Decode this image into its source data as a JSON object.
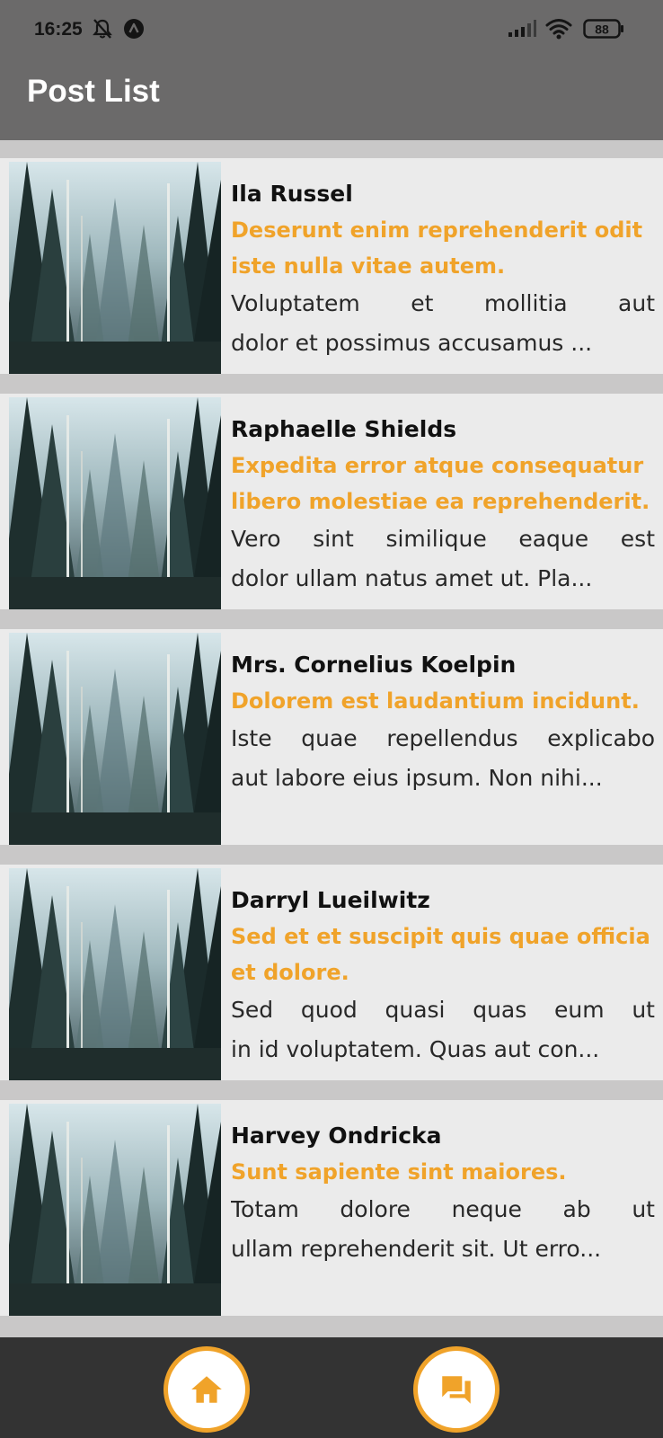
{
  "status_bar": {
    "time": "16:25",
    "battery_level": "88",
    "icons": [
      "muted-bell-icon",
      "app-notification-icon",
      "signal-icon",
      "wifi-icon",
      "battery-icon"
    ]
  },
  "app_bar": {
    "title": "Post List"
  },
  "colors": {
    "accent": "#f0a32a",
    "app_bar": "#6b6a6a",
    "bottom_nav": "#333333",
    "card": "#ebebeb",
    "list_background": "#c9c8c8"
  },
  "posts": [
    {
      "author": "Ila Russel",
      "title": "Deserunt enim reprehenderit odit iste nulla vitae autem.",
      "excerpt_line1": "Voluptatem et mollitia aut",
      "excerpt_line2": "dolor et possimus accusamus ..."
    },
    {
      "author": "Raphaelle Shields",
      "title": "Expedita error atque consequatur libero molestiae ea reprehenderit.",
      "excerpt_line1": "Vero sint similique eaque est",
      "excerpt_line2": "dolor ullam natus amet ut. Pla..."
    },
    {
      "author": "Mrs. Cornelius Koelpin",
      "title": "Dolorem est laudantium incidunt.",
      "excerpt_line1": "Iste quae repellendus explicabo",
      "excerpt_line2": "aut labore eius ipsum. Non nihi..."
    },
    {
      "author": "Darryl Lueilwitz",
      "title": "Sed et et suscipit quis quae officia et dolore.",
      "excerpt_line1": "Sed quod quasi quas eum ut",
      "excerpt_line2": "in id voluptatem. Quas aut con..."
    },
    {
      "author": "Harvey Ondricka",
      "title": "Sunt sapiente sint maiores.",
      "excerpt_line1": "Totam dolore neque ab ut",
      "excerpt_line2": "ullam reprehenderit sit. Ut erro..."
    }
  ],
  "bottom_nav": {
    "items": [
      {
        "icon": "home-icon"
      },
      {
        "icon": "forum-icon"
      }
    ]
  }
}
